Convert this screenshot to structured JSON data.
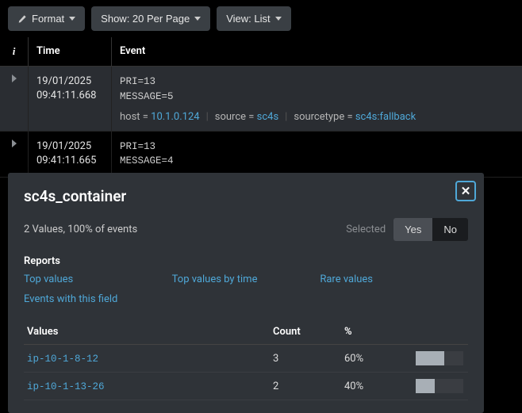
{
  "toolbar": {
    "format_label": "Format",
    "show_label": "Show: 20 Per Page",
    "view_label": "View: List"
  },
  "header": {
    "i": "i",
    "time": "Time",
    "event": "Event"
  },
  "rows": [
    {
      "date": "19/01/2025",
      "time": "09:41:11.668",
      "raw1": "PRI=13",
      "raw2": "MESSAGE=5",
      "host_k": "host =",
      "host_v": "10.1.0.124",
      "source_k": "source =",
      "source_v": "sc4s",
      "st_k": "sourcetype =",
      "st_v": "sc4s:fallback"
    },
    {
      "date": "19/01/2025",
      "time": "09:41:11.665",
      "raw1": "PRI=13",
      "raw2": "MESSAGE=4"
    }
  ],
  "popup": {
    "title": "sc4s_container",
    "sub": "2 Values, 100% of events",
    "selected_label": "Selected",
    "yes": "Yes",
    "no": "No",
    "reports_label": "Reports",
    "links": {
      "top_values": "Top values",
      "top_values_time": "Top values by time",
      "rare_values": "Rare values",
      "events_with": "Events with this field"
    },
    "table": {
      "h_values": "Values",
      "h_count": "Count",
      "h_pct": "%",
      "rows": [
        {
          "value": "ip-10-1-8-12",
          "count": "3",
          "pct": "60%",
          "bar": 60
        },
        {
          "value": "ip-10-1-13-26",
          "count": "2",
          "pct": "40%",
          "bar": 40
        }
      ]
    }
  }
}
